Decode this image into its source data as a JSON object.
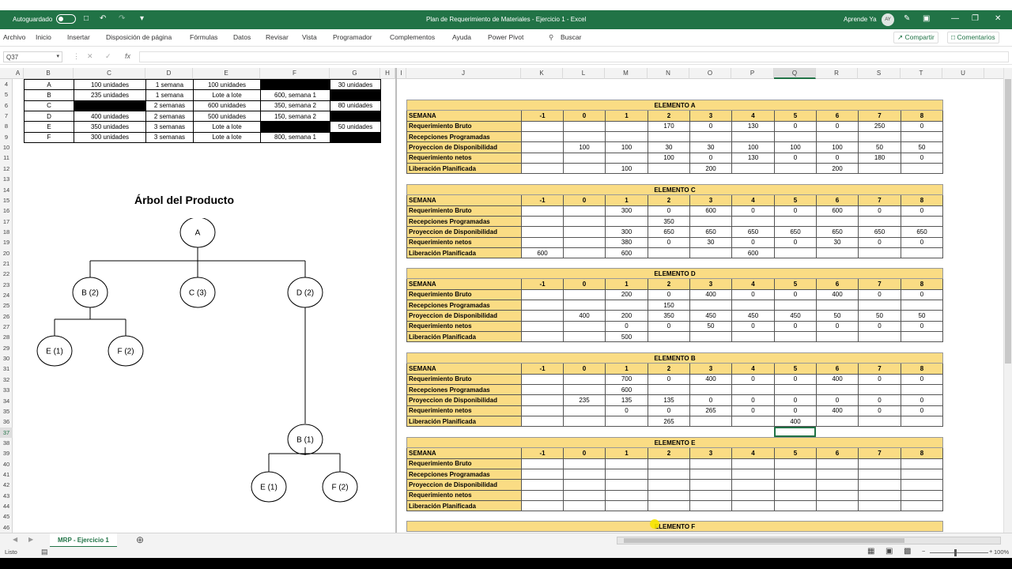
{
  "window": {
    "autosave": "Autoguardado",
    "title": "Plan de Requerimiento de Materiales - Ejercicio 1  -  Excel",
    "user": "Aprende Ya",
    "avatar": "AY"
  },
  "menu": [
    "Archivo",
    "Inicio",
    "Insertar",
    "Disposición de página",
    "Fórmulas",
    "Datos",
    "Revisar",
    "Vista",
    "Programador",
    "Complementos",
    "Ayuda",
    "Power Pivot",
    "Buscar"
  ],
  "share": "Compartir",
  "comments": "Comentarios",
  "formula": {
    "namebox": "Q37",
    "fx": "fx",
    "value": ""
  },
  "columns_left": [
    "A",
    "B",
    "C",
    "D",
    "E",
    "F",
    "G",
    "H",
    "I"
  ],
  "columns_right": [
    "J",
    "K",
    "L",
    "M",
    "N",
    "O",
    "P",
    "Q",
    "R",
    "S",
    "T",
    "U"
  ],
  "rows": [
    "4",
    "5",
    "6",
    "7",
    "8",
    "9",
    "10",
    "11",
    "12",
    "13",
    "14",
    "15",
    "16",
    "17",
    "18",
    "19",
    "20",
    "21",
    "22",
    "23",
    "24",
    "25",
    "26",
    "27",
    "28",
    "29",
    "30",
    "31",
    "32",
    "33",
    "34",
    "35",
    "36",
    "37",
    "38",
    "39",
    "40",
    "41",
    "42",
    "43",
    "44",
    "45",
    "46"
  ],
  "left_table": [
    [
      "A",
      "100 unidades",
      "1 semana",
      "100 unidades",
      "",
      "30 unidades"
    ],
    [
      "B",
      "235 unidades",
      "1 semana",
      "Lote a lote",
      "600, semana 1",
      ""
    ],
    [
      "C",
      "",
      "2 semanas",
      "600 unidades",
      "350, semana 2",
      "80 unidades"
    ],
    [
      "D",
      "400 unidades",
      "2 semanas",
      "500 unidades",
      "150, semana 2",
      ""
    ],
    [
      "E",
      "350 unidades",
      "3 semanas",
      "Lote a lote",
      "",
      "50 unidades"
    ],
    [
      "F",
      "300 unidades",
      "3 semanas",
      "Lote a lote",
      "800, semana 1",
      ""
    ]
  ],
  "tree": {
    "title": "Árbol del Producto",
    "nodes": [
      "A",
      "B (2)",
      "C (3)",
      "D (2)",
      "E (1)",
      "F (2)",
      "B (1)",
      "E (1)",
      "F (2)"
    ]
  },
  "mrp_labels": {
    "header": "SEMANA",
    "rows": [
      "Requerimiento Bruto",
      "Recepciones Programadas",
      "Proyeccion de Disponibilidad",
      "Requerimiento netos",
      "Liberación Planificada"
    ]
  },
  "weeks": [
    "-1",
    "0",
    "1",
    "2",
    "3",
    "4",
    "5",
    "6",
    "7",
    "8"
  ],
  "elements": [
    {
      "name": "ELEMENTO A",
      "rows": [
        [
          "",
          "",
          "",
          "170",
          "0",
          "130",
          "0",
          "0",
          "250",
          "0"
        ],
        [
          "",
          "",
          "",
          "",
          "",
          "",
          "",
          "",
          "",
          ""
        ],
        [
          "",
          "100",
          "100",
          "30",
          "30",
          "100",
          "100",
          "100",
          "50",
          "50"
        ],
        [
          "",
          "",
          "",
          "100",
          "0",
          "130",
          "0",
          "0",
          "180",
          "0"
        ],
        [
          "",
          "",
          "100",
          "",
          "200",
          "",
          "",
          "200",
          "",
          ""
        ]
      ]
    },
    {
      "name": "ELEMENTO C",
      "rows": [
        [
          "",
          "",
          "300",
          "0",
          "600",
          "0",
          "0",
          "600",
          "0",
          "0"
        ],
        [
          "",
          "",
          "",
          "350",
          "",
          "",
          "",
          "",
          "",
          ""
        ],
        [
          "",
          "",
          "300",
          "650",
          "650",
          "650",
          "650",
          "650",
          "650",
          "650"
        ],
        [
          "",
          "",
          "380",
          "0",
          "30",
          "0",
          "0",
          "30",
          "0",
          "0"
        ],
        [
          "600",
          "",
          "600",
          "",
          "",
          "600",
          "",
          "",
          "",
          ""
        ]
      ]
    },
    {
      "name": "ELEMENTO D",
      "rows": [
        [
          "",
          "",
          "200",
          "0",
          "400",
          "0",
          "0",
          "400",
          "0",
          "0"
        ],
        [
          "",
          "",
          "",
          "150",
          "",
          "",
          "",
          "",
          "",
          ""
        ],
        [
          "",
          "400",
          "200",
          "350",
          "450",
          "450",
          "450",
          "50",
          "50",
          "50"
        ],
        [
          "",
          "",
          "0",
          "0",
          "50",
          "0",
          "0",
          "0",
          "0",
          "0"
        ],
        [
          "",
          "",
          "500",
          "",
          "",
          "",
          "",
          "",
          "",
          ""
        ]
      ]
    },
    {
      "name": "ELEMENTO B",
      "rows": [
        [
          "",
          "",
          "700",
          "0",
          "400",
          "0",
          "0",
          "400",
          "0",
          "0"
        ],
        [
          "",
          "",
          "600",
          "",
          "",
          "",
          "",
          "",
          "",
          ""
        ],
        [
          "",
          "235",
          "135",
          "135",
          "0",
          "0",
          "0",
          "0",
          "0",
          "0"
        ],
        [
          "",
          "",
          "0",
          "0",
          "265",
          "0",
          "0",
          "400",
          "0",
          "0"
        ],
        [
          "",
          "",
          "",
          "265",
          "",
          "",
          "400",
          "",
          "",
          ""
        ]
      ]
    },
    {
      "name": "ELEMENTO E",
      "rows": [
        [
          "",
          "",
          "",
          "",
          "",
          "",
          "",
          "",
          "",
          ""
        ],
        [
          "",
          "",
          "",
          "",
          "",
          "",
          "",
          "",
          "",
          ""
        ],
        [
          "",
          "",
          "",
          "",
          "",
          "",
          "",
          "",
          "",
          ""
        ],
        [
          "",
          "",
          "",
          "",
          "",
          "",
          "",
          "",
          "",
          ""
        ],
        [
          "",
          "",
          "",
          "",
          "",
          "",
          "",
          "",
          "",
          ""
        ]
      ]
    },
    {
      "name": "ELEMENTO F",
      "rows": []
    }
  ],
  "sheet_tab": "MRP - Ejercicio 1",
  "status": {
    "ready": "Listo",
    "zoom": "100%"
  }
}
